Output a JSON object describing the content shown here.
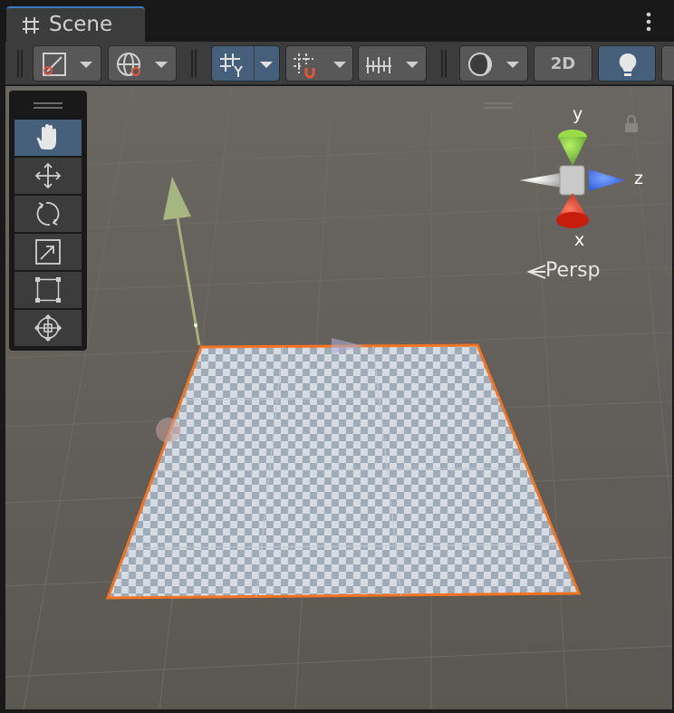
{
  "tab": {
    "title": "Scene",
    "icon": "hash-grid-icon"
  },
  "toolbar": {
    "draw_mode_icon": "draw-mode-icon",
    "global_icon": "globe-pivot-icon",
    "grid_icon": "grid-visibility-icon",
    "snap_icon": "grid-snap-icon",
    "increment_icon": "increment-snap-icon",
    "shading_icon": "shading-sphere-icon",
    "btn_2d": "2D",
    "lighting_icon": "lightbulb-icon"
  },
  "tools": [
    {
      "name": "hand-tool",
      "icon": "hand-icon",
      "selected": true
    },
    {
      "name": "move-tool",
      "icon": "move-arrows-icon",
      "selected": false
    },
    {
      "name": "rotate-tool",
      "icon": "rotate-icon",
      "selected": false
    },
    {
      "name": "scale-tool",
      "icon": "scale-icon",
      "selected": false
    },
    {
      "name": "rect-tool",
      "icon": "rect-transform-icon",
      "selected": false
    },
    {
      "name": "transform-tool",
      "icon": "transform-icon",
      "selected": false
    }
  ],
  "gizmo": {
    "y": "y",
    "x": "x",
    "z": "z",
    "projection": "Persp",
    "lock_icon": "lock-icon"
  },
  "colors": {
    "accent": "#3a79bb",
    "selection_outline": "#f37321",
    "axis_x": "#db3b26",
    "axis_y": "#8bc34a",
    "axis_z": "#3b70e6"
  }
}
